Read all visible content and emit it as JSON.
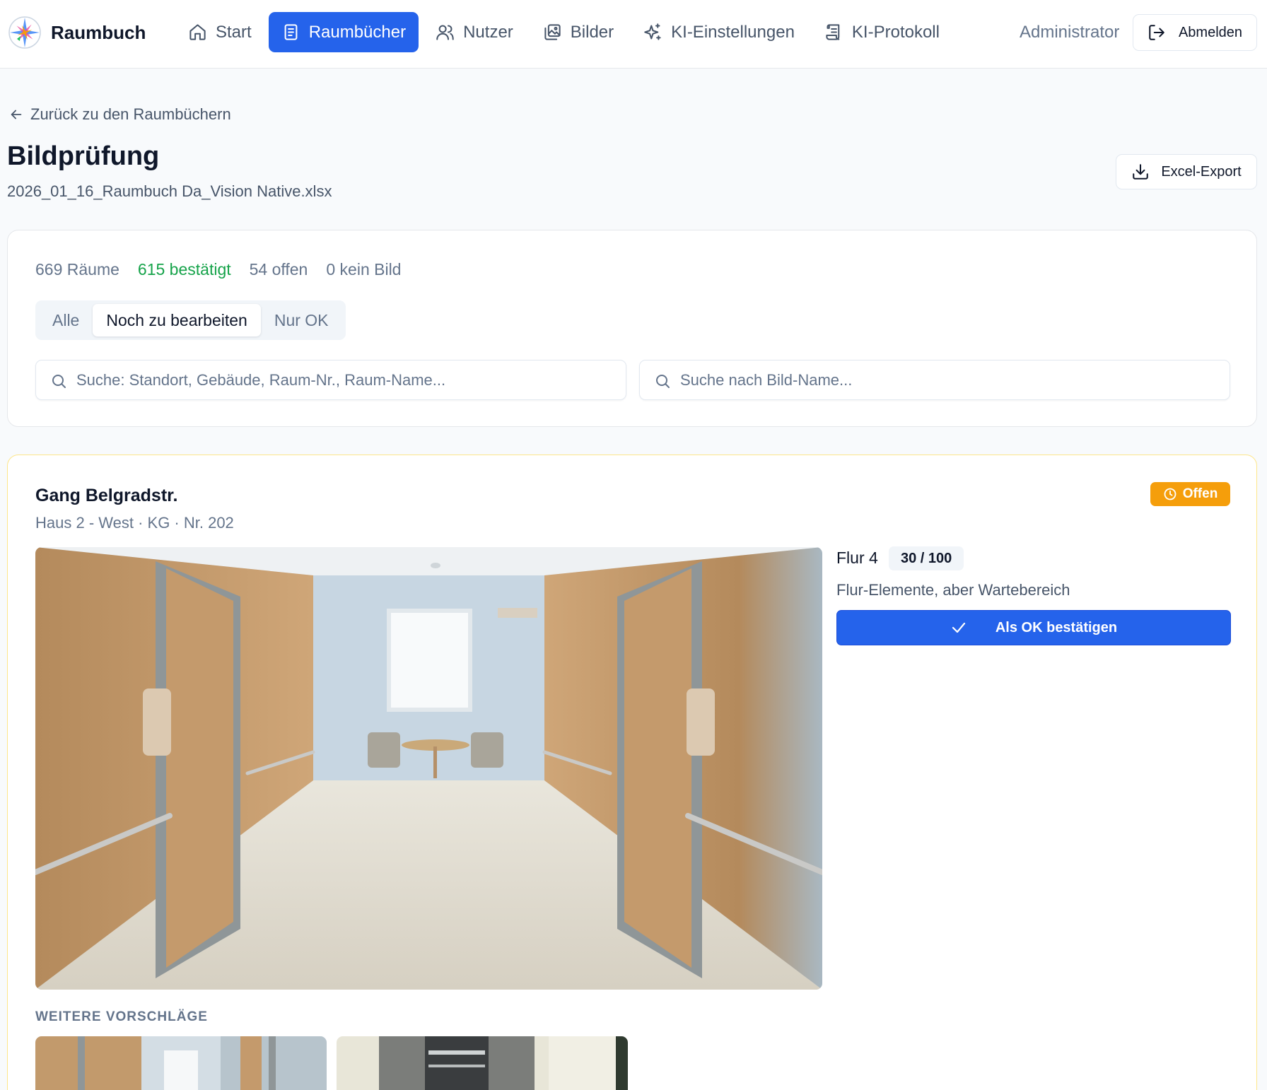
{
  "app": {
    "name": "Raumbuch",
    "logo_icon": "compass-star-logo-icon"
  },
  "nav": {
    "items": [
      {
        "label": "Start",
        "icon": "home-icon",
        "active": false
      },
      {
        "label": "Raumbücher",
        "icon": "book-icon",
        "active": true
      },
      {
        "label": "Nutzer",
        "icon": "users-icon",
        "active": false
      },
      {
        "label": "Bilder",
        "icon": "images-icon",
        "active": false
      },
      {
        "label": "KI-Einstellungen",
        "icon": "sparkles-icon",
        "active": false
      },
      {
        "label": "KI-Protokoll",
        "icon": "scroll-icon",
        "active": false
      }
    ],
    "user": "Administrator",
    "logout_label": "Abmelden",
    "accent_color": "#2563eb"
  },
  "header": {
    "back_label": "Zurück zu den Raumbüchern",
    "title": "Bildprüfung",
    "subtitle": "2026_01_16_Raumbuch Da_Vision Native.xlsx",
    "export_label": "Excel-Export"
  },
  "filters": {
    "stats": {
      "rooms": "669 Räume",
      "confirmed": "615 bestätigt",
      "open": "54 offen",
      "no_image": "0 kein Bild"
    },
    "segments": [
      "Alle",
      "Noch zu bearbeiten",
      "Nur OK"
    ],
    "active_segment": "Noch zu bearbeiten",
    "search_room_placeholder": "Suche: Standort, Gebäude, Raum-Nr., Raum-Name...",
    "search_image_placeholder": "Suche nach Bild-Name..."
  },
  "room": {
    "name": "Gang Belgradstr.",
    "meta": "Haus 2 - West · KG · Nr. 202",
    "status": "Offen",
    "status_color": "#f59e0b",
    "image_label": "Flur 4",
    "score": "30 / 100",
    "description": "Flur-Elemente, aber Wartebereich",
    "confirm_label": "Als OK bestätigen",
    "more_heading": "WEITERE VORSCHLÄGE"
  }
}
